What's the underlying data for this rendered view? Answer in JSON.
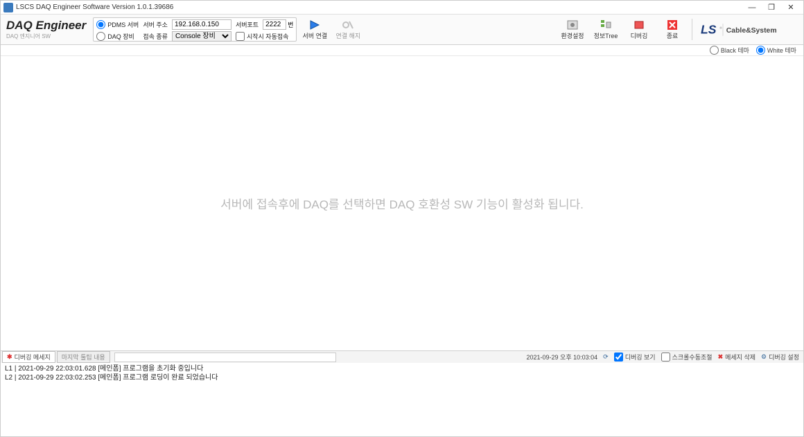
{
  "window": {
    "title": "LSCS DAQ Engineer Software Version 1.0.1.39686"
  },
  "brand": {
    "main": "DAQ Engineer",
    "sub": "DAQ 엔지니어 SW"
  },
  "conn": {
    "radio_pdms": "PDMS 서버",
    "radio_daq": "DAQ 장비",
    "addr_label": "서버 주소",
    "addr_value": "192.168.0.150",
    "port_label": "서버포트",
    "port_value": "2222",
    "port_unit": "번",
    "type_label": "접속 종류",
    "type_value": "Console 장비",
    "auto_label": "시작시 자동접속"
  },
  "buttons": {
    "connect": "서버 연결",
    "disconnect": "연결 해지",
    "settings": "환경설정",
    "tree": "정보Tree",
    "debug": "디버깅",
    "exit": "종료"
  },
  "theme": {
    "black": "Black 테마",
    "white": "White 테마"
  },
  "main_message": "서버에 접속후에 DAQ를 선택하면 DAQ 호환성 SW 기능이 활성화 됩니다.",
  "status": {
    "tab_debug": "디버깅 메세지",
    "tab_tooltip": "마지막 툴팁 내용",
    "timestamp": "2021-09-29 오후 10:03:04",
    "chk_view": "디버깅 보기",
    "chk_scroll": "스크롤수동조절",
    "btn_delete": "메세지 삭제",
    "btn_settings": "디버깅 설정"
  },
  "logs": [
    "L1 |  2021-09-29 22:03:01.628 [메인폼] 프로그램을 초기화 중입니다",
    "L2 |  2021-09-29 22:03:02.253 [메인폼] 프로그램 로딩이 완료 되었습니다"
  ],
  "logo_text": "Cable&System"
}
